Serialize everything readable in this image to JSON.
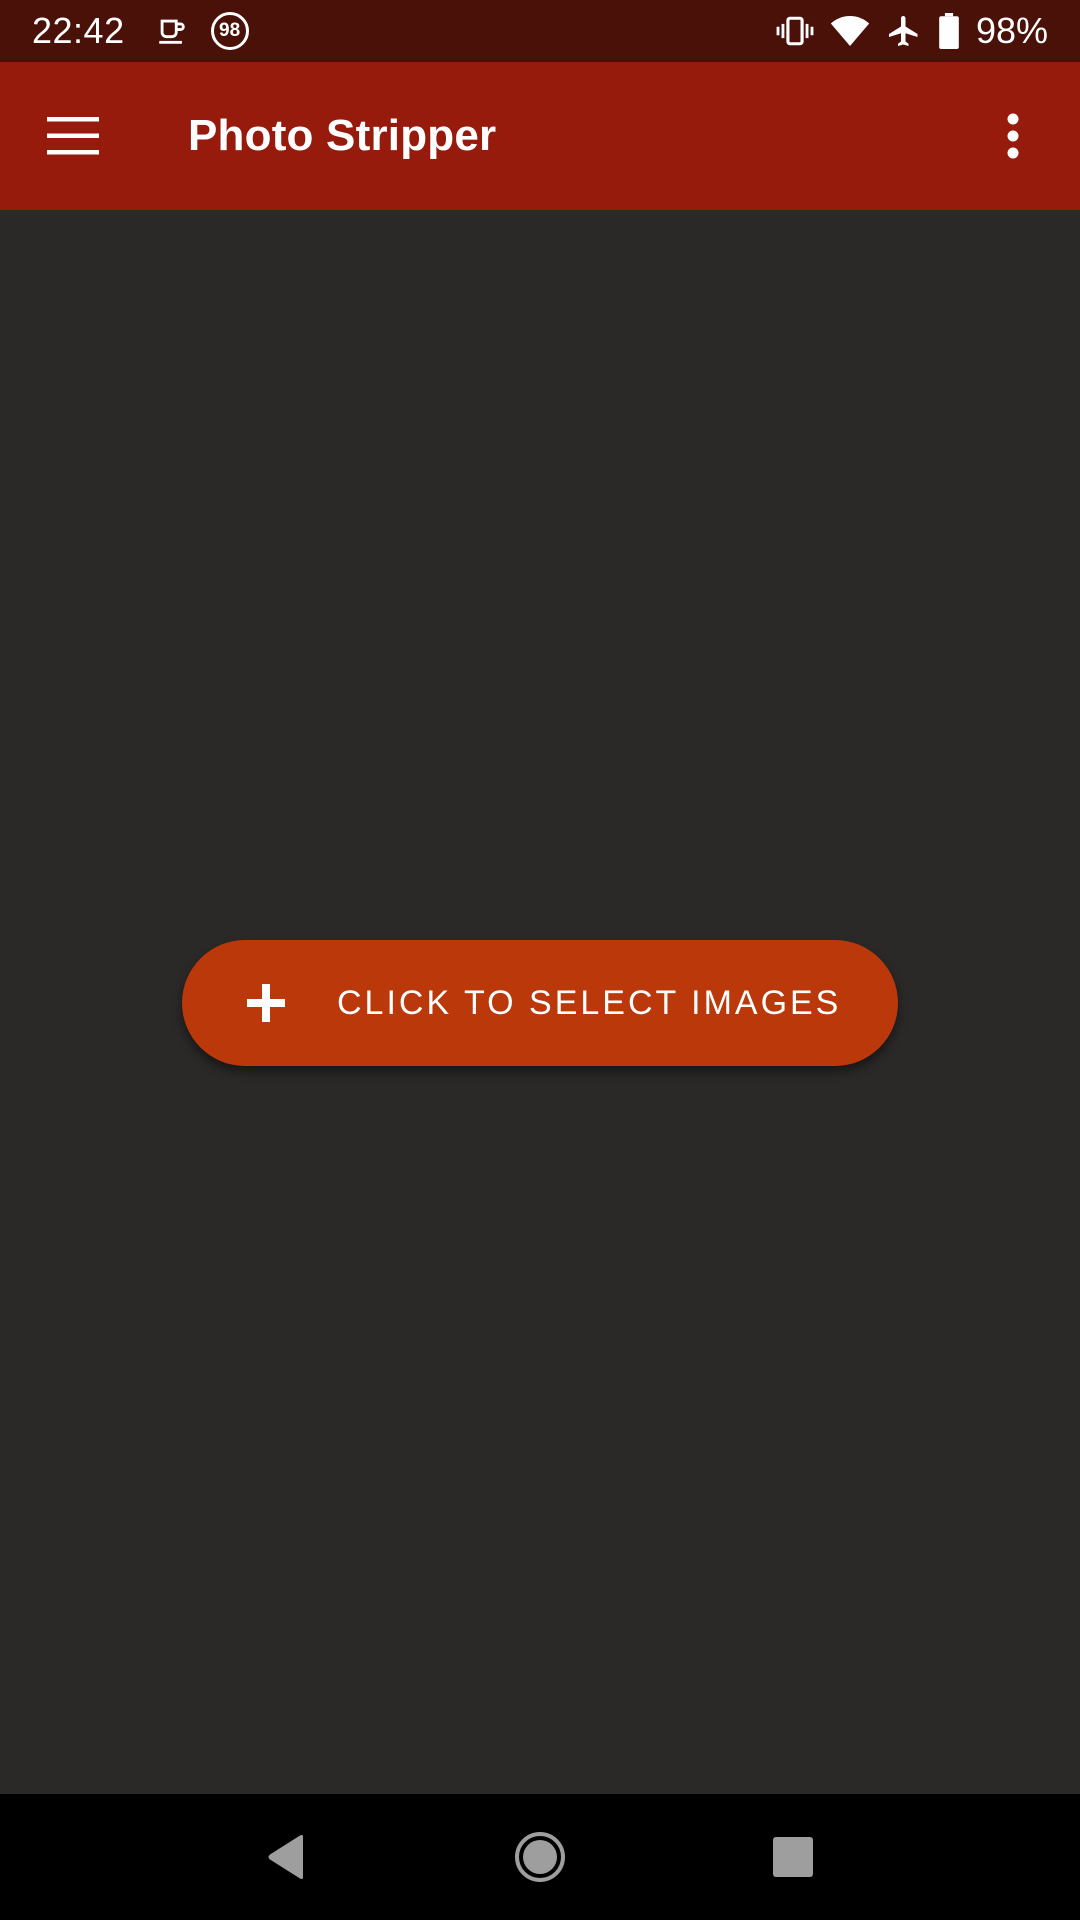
{
  "status_bar": {
    "time": "22:42",
    "notification_badge": "98",
    "battery_percent": "98%",
    "icons": [
      "coffee-cup-icon",
      "circle-98-icon",
      "vibrate-icon",
      "wifi-icon",
      "airplane-icon",
      "battery-icon"
    ]
  },
  "app_bar": {
    "title": "Photo Stripper",
    "menu_icon": "hamburger-menu-icon",
    "overflow_icon": "more-vert-icon"
  },
  "main": {
    "select_button_label": "CLICK TO SELECT IMAGES",
    "select_button_icon": "plus-icon"
  },
  "nav_bar": {
    "icons": [
      "back-icon",
      "home-icon",
      "recents-icon"
    ]
  },
  "colors": {
    "status_bar": "#4a1109",
    "app_bar": "#961b0d",
    "background": "#2b2928",
    "button": "#bb380b",
    "nav_bar": "#000000"
  }
}
